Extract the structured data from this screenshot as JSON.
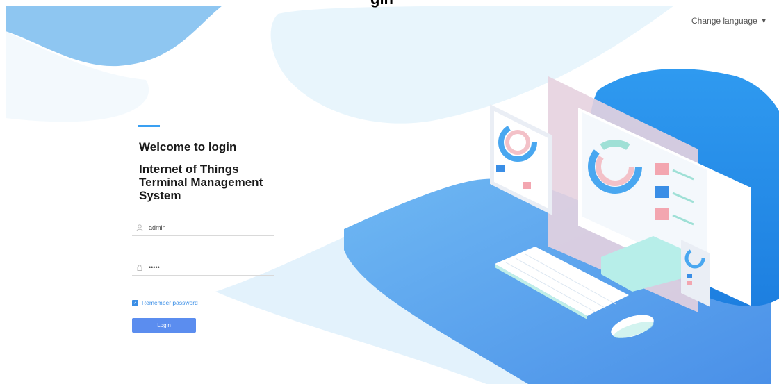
{
  "header": {
    "cropped_title": "gin",
    "language_label": "Change language",
    "language_caret": "▼"
  },
  "login": {
    "welcome": "Welcome to login",
    "system_title": "Internet of Things Terminal Management System",
    "username_value": "admin",
    "password_value": "•••••",
    "remember_label": "Remember password",
    "remember_checked": true,
    "login_button": "Login"
  },
  "colors": {
    "accent": "#3aa0f2",
    "button": "#5b8def",
    "link": "#3a8ee6"
  },
  "icons": {
    "username": "user-icon",
    "password": "lock-icon",
    "language": "caret-down-icon",
    "remember": "checkbox-checked-icon"
  }
}
